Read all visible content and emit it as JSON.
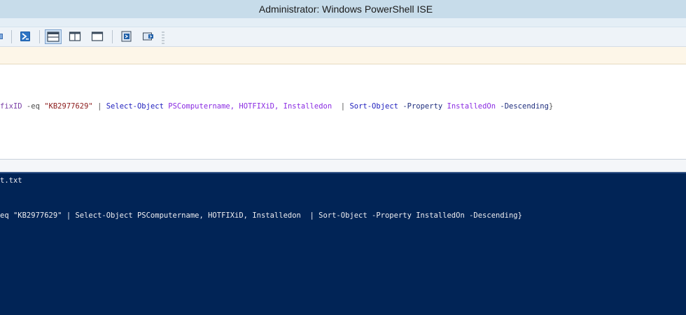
{
  "window": {
    "title": "Administrator: Windows PowerShell ISE"
  },
  "toolbar": {
    "buttons": [
      {
        "name": "run-selection-icon"
      },
      {
        "name": "new-remote-powershell-tab-icon"
      },
      {
        "name": "layout-script-top-icon"
      },
      {
        "name": "layout-script-right-icon"
      },
      {
        "name": "layout-script-maximized-icon"
      },
      {
        "name": "show-script-pane-icon"
      },
      {
        "name": "show-command-window-icon"
      }
    ]
  },
  "script_pane": {
    "tokens": [
      {
        "text": "fixID",
        "type": "var"
      },
      {
        "text": " -eq ",
        "type": "op"
      },
      {
        "text": "\"KB2977629\"",
        "type": "str"
      },
      {
        "text": " | ",
        "type": "punct"
      },
      {
        "text": "Select-Object",
        "type": "cmd"
      },
      {
        "text": " PSComputername,",
        "type": "arg"
      },
      {
        "text": " HOTFIXiD,",
        "type": "arg"
      },
      {
        "text": " Installedon",
        "type": "arg"
      },
      {
        "text": "  | ",
        "type": "punct"
      },
      {
        "text": "Sort-Object",
        "type": "cmd"
      },
      {
        "text": " -Property",
        "type": "param"
      },
      {
        "text": " InstalledOn",
        "type": "arg"
      },
      {
        "text": " -Descending",
        "type": "param"
      },
      {
        "text": "}",
        "type": "punct"
      }
    ]
  },
  "console_pane": {
    "line1": "t.txt",
    "line2": "eq \"KB2977629\" | Select-Object PSComputername, HOTFIXiD, Installedon  | Sort-Object -Property InstalledOn -Descending}"
  },
  "colors": {
    "console_bg": "#012456",
    "titlebar_bg": "#c7dcea"
  }
}
